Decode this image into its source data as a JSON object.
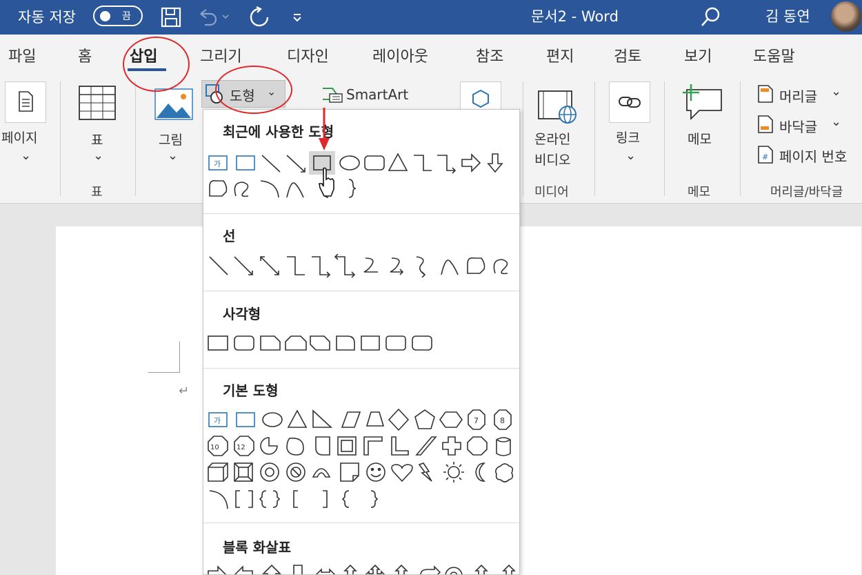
{
  "titlebar": {
    "autosave_label": "자동 저장",
    "autosave_state": "끔",
    "document_title": "문서2  -  Word",
    "user_name": "김 동연",
    "bg_color": "#2b579a"
  },
  "tabs": [
    {
      "label": "파일"
    },
    {
      "label": "홈"
    },
    {
      "label": "삽입",
      "active": true
    },
    {
      "label": "그리기"
    },
    {
      "label": "디자인"
    },
    {
      "label": "레이아웃"
    },
    {
      "label": "참조"
    },
    {
      "label": "편지"
    },
    {
      "label": "검토"
    },
    {
      "label": "보기"
    },
    {
      "label": "도움말"
    }
  ],
  "ribbon": {
    "page": {
      "label": "페이지"
    },
    "table": {
      "label": "표",
      "group": "표"
    },
    "picture": {
      "label": "그림"
    },
    "shapes": {
      "label": "도형"
    },
    "smartart": {
      "label": "SmartArt"
    },
    "online_video": {
      "line1": "온라인",
      "line2": "비디오",
      "group": "미디어"
    },
    "link": {
      "label": "링크"
    },
    "comment": {
      "label": "메모",
      "group": "메모"
    },
    "header": {
      "label": "머리글"
    },
    "footer": {
      "label": "바닥글"
    },
    "page_number": {
      "label": "페이지 번호"
    },
    "header_footer_group": "머리글/바닥글"
  },
  "shapes_dropdown": {
    "sections": [
      {
        "title": "최근에 사용한 도형"
      },
      {
        "title": "선"
      },
      {
        "title": "사각형"
      },
      {
        "title": "기본 도형"
      },
      {
        "title": "블록 화살표"
      }
    ],
    "textbox_glyph": "가",
    "octagon_labels": [
      "7",
      "8",
      "10",
      "12"
    ]
  },
  "colors": {
    "accent": "#2b579a",
    "annotation_red": "#e0282c",
    "selected_shape_bg": "#d6d6d6"
  },
  "icons": [
    "save-icon",
    "undo-icon",
    "redo-icon",
    "customize-qat-icon",
    "search-icon",
    "mouse-cursor-icon",
    "red-arrow-icon"
  ]
}
